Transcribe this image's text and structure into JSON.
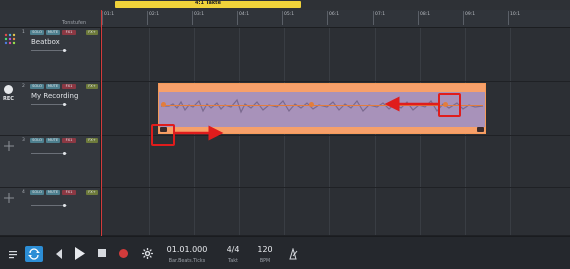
{
  "topbar": {
    "range_label": "4:1 Takte"
  },
  "header": {
    "tonstufen_label": "Tonstufen"
  },
  "ruler": {
    "ticks": [
      "01:1",
      "02:1",
      "03:1",
      "04:1",
      "05:1",
      "06:1",
      "07:1",
      "08:1",
      "09:1",
      "10:1"
    ]
  },
  "tracks": [
    {
      "number": "1",
      "name": "Beatbox",
      "solo": "SOLO",
      "mute": "MUTE",
      "fx": "FX1",
      "fx2": "FX+"
    },
    {
      "number": "2",
      "name": "My Recording",
      "solo": "SOLO",
      "mute": "MUTE",
      "fx": "FX1",
      "fx2": "FX+",
      "rec_label": "REC"
    },
    {
      "number": "3",
      "solo": "SOLO",
      "mute": "MUTE",
      "fx": "FX1",
      "fx2": "FX+"
    },
    {
      "number": "4",
      "solo": "SOLO",
      "mute": "MUTE",
      "fx": "FX1",
      "fx2": "FX+"
    }
  ],
  "transport": {
    "position": "01.01.000",
    "position_label": "Bar.Beats.Ticks",
    "time_signature": "4/4",
    "time_signature_label": "Takt",
    "tempo": "120",
    "tempo_label": "BPM"
  },
  "colors": {
    "clip": "#a892ba",
    "clip_border": "#f7a06a",
    "annotation": "#e01c1c",
    "playhead": "#d23b3b",
    "loop_active": "#2c8ed6"
  }
}
